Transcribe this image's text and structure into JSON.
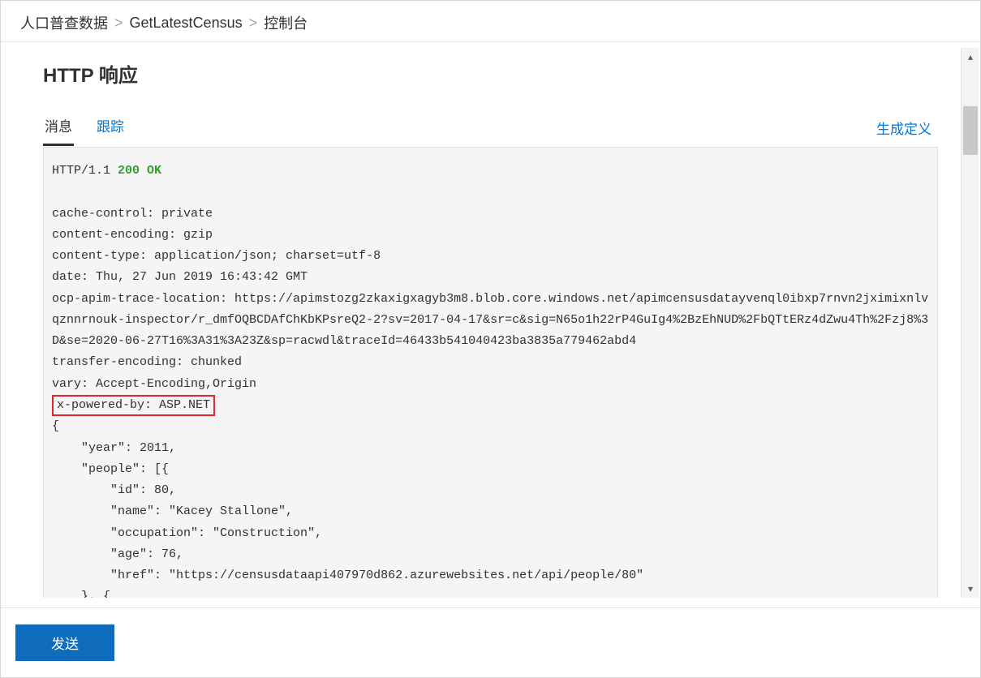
{
  "breadcrumb": {
    "item1": "人口普查数据",
    "item2": "GetLatestCensus",
    "item3": "控制台",
    "sep": ">"
  },
  "section": {
    "title": "HTTP 响应"
  },
  "tabs": {
    "message": "消息",
    "trace": "跟踪",
    "generate": "生成定义"
  },
  "response": {
    "protocol": "HTTP/1.1",
    "status": "200 OK",
    "headers": {
      "cache_control": "cache-control: private",
      "content_encoding": "content-encoding: gzip",
      "content_type": "content-type: application/json; charset=utf-8",
      "date": "date: Thu, 27 Jun 2019 16:43:42 GMT",
      "ocp": "ocp-apim-trace-location: https://apimstozg2zkaxigxagyb3m8.blob.core.windows.net/apimcensusdatayvenql0ibxp7rnvn2jximixnlvqznnrnouk-inspector/r_dmfOQBCDAfChKbKPsreQ2-2?sv=2017-04-17&sr=c&sig=N65o1h22rP4GuIg4%2BzEhNUD%2FbQTtERz4dZwu4Th%2Fzj8%3D&se=2020-06-27T16%3A31%3A23Z&sp=racwdl&traceId=46433b541040423ba3835a779462abd4",
      "transfer_encoding": "transfer-encoding: chunked",
      "vary": "vary: Accept-Encoding,Origin",
      "x_powered_by": "x-powered-by: ASP.NET"
    },
    "body_lines": [
      "{",
      "    \"year\": 2011,",
      "    \"people\": [{",
      "        \"id\": 80,",
      "        \"name\": \"Kacey Stallone\",",
      "        \"occupation\": \"Construction\",",
      "        \"age\": 76,",
      "        \"href\": \"https://censusdataapi407970d862.azurewebsites.net/api/people/80\"",
      "    }, {"
    ]
  },
  "footer": {
    "send": "发送"
  }
}
